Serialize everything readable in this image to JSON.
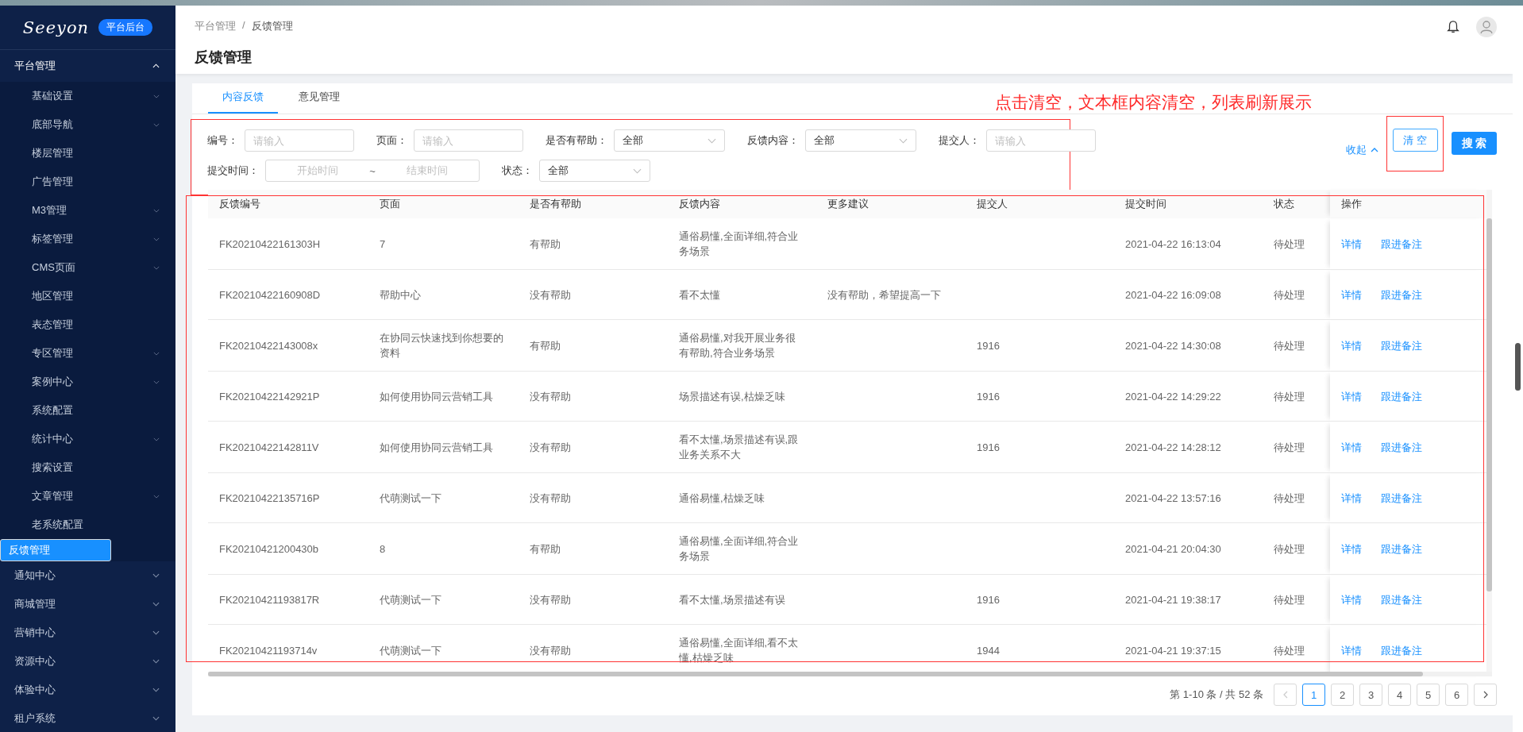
{
  "sidebar": {
    "logo": "Seeyon",
    "badge": "平台后台",
    "groups": [
      {
        "label": "平台管理",
        "expanded": true,
        "children": [
          {
            "label": "基础设置",
            "has_submenu": true,
            "selected": false
          },
          {
            "label": "底部导航",
            "has_submenu": true,
            "selected": false
          },
          {
            "label": "楼层管理",
            "has_submenu": false,
            "selected": false
          },
          {
            "label": "广告管理",
            "has_submenu": false,
            "selected": false
          },
          {
            "label": "M3管理",
            "has_submenu": true,
            "selected": false
          },
          {
            "label": "标签管理",
            "has_submenu": true,
            "selected": false
          },
          {
            "label": "CMS页面",
            "has_submenu": true,
            "selected": false
          },
          {
            "label": "地区管理",
            "has_submenu": false,
            "selected": false
          },
          {
            "label": "表态管理",
            "has_submenu": false,
            "selected": false
          },
          {
            "label": "专区管理",
            "has_submenu": true,
            "selected": false
          },
          {
            "label": "案例中心",
            "has_submenu": true,
            "selected": false
          },
          {
            "label": "系统配置",
            "has_submenu": false,
            "selected": false
          },
          {
            "label": "统计中心",
            "has_submenu": true,
            "selected": false
          },
          {
            "label": "搜索设置",
            "has_submenu": false,
            "selected": false
          },
          {
            "label": "文章管理",
            "has_submenu": true,
            "selected": false
          },
          {
            "label": "老系统配置",
            "has_submenu": false,
            "selected": false
          },
          {
            "label": "反馈管理",
            "has_submenu": false,
            "selected": true
          }
        ]
      },
      {
        "label": "通知中心",
        "expanded": false
      },
      {
        "label": "商城管理",
        "expanded": false
      },
      {
        "label": "营销中心",
        "expanded": false
      },
      {
        "label": "资源中心",
        "expanded": false
      },
      {
        "label": "体验中心",
        "expanded": false
      },
      {
        "label": "租户系统",
        "expanded": false
      }
    ]
  },
  "breadcrumb": [
    "平台管理",
    "反馈管理"
  ],
  "breadcrumb_separator": "/",
  "page_title": "反馈管理",
  "tabs": [
    {
      "label": "内容反馈",
      "selected": true
    },
    {
      "label": "意见管理",
      "selected": false
    }
  ],
  "annotation": "点击清空，文本框内容清空，列表刷新展示",
  "filters": [
    [
      {
        "kind": "input",
        "label": "编号：",
        "placeholder": "请输入"
      },
      {
        "kind": "input",
        "label": "页面：",
        "placeholder": "请输入"
      },
      {
        "kind": "select",
        "label": "是否有帮助：",
        "value": "全部"
      },
      {
        "kind": "select",
        "label": "反馈内容：",
        "value": "全部"
      },
      {
        "kind": "input",
        "label": "提交人：",
        "placeholder": "请输入"
      }
    ],
    [
      {
        "kind": "daterange",
        "label": "提交时间：",
        "start_placeholder": "开始时间",
        "separator": "~",
        "end_placeholder": "结束时间"
      },
      {
        "kind": "select",
        "label": "状态：",
        "value": "全部"
      }
    ]
  ],
  "collapse_link": "收起",
  "buttons": {
    "clear": "清 空",
    "search": "搜 索"
  },
  "table": {
    "columns": [
      "反馈编号",
      "页面",
      "是否有帮助",
      "反馈内容",
      "更多建议",
      "提交人",
      "提交时间",
      "状态",
      "操作"
    ],
    "rows": [
      {
        "id": "FK20210422161303H",
        "page": "7",
        "helpful": "有帮助",
        "content": "通俗易懂,全面详细,符合业务场景",
        "time": "2021-04-22 16:13:04",
        "status": "待处理",
        "actions": [
          "详情",
          "跟进备注"
        ]
      },
      {
        "id": "FK20210422160908D",
        "page": "帮助中心",
        "helpful": "没有帮助",
        "content": "看不太懂",
        "suggestion": "没有帮助，希望提高一下",
        "time": "2021-04-22 16:09:08",
        "status": "待处理",
        "actions": [
          "详情",
          "跟进备注"
        ]
      },
      {
        "id": "FK20210422143008x",
        "page": "在协同云快速找到你想要的资料",
        "helpful": "有帮助",
        "content": "通俗易懂,对我开展业务很有帮助,符合业务场景",
        "submitter": "1916",
        "time": "2021-04-22 14:30:08",
        "status": "待处理",
        "actions": [
          "详情",
          "跟进备注"
        ]
      },
      {
        "id": "FK20210422142921P",
        "page": "如何使用协同云营销工具",
        "helpful": "没有帮助",
        "content": "场景描述有误,枯燥乏味",
        "submitter": "1916",
        "time": "2021-04-22 14:29:22",
        "status": "待处理",
        "actions": [
          "详情",
          "跟进备注"
        ]
      },
      {
        "id": "FK20210422142811V",
        "page": "如何使用协同云营销工具",
        "helpful": "没有帮助",
        "content": "看不太懂,场景描述有误,跟业务关系不大",
        "submitter": "1916",
        "time": "2021-04-22 14:28:12",
        "status": "待处理",
        "actions": [
          "详情",
          "跟进备注"
        ]
      },
      {
        "id": "FK20210422135716P",
        "page": "代萌测试一下",
        "helpful": "没有帮助",
        "content": "通俗易懂,枯燥乏味",
        "time": "2021-04-22 13:57:16",
        "status": "待处理",
        "actions": [
          "详情",
          "跟进备注"
        ]
      },
      {
        "id": "FK20210421200430b",
        "page": "8",
        "helpful": "有帮助",
        "content": "通俗易懂,全面详细,符合业务场景",
        "time": "2021-04-21 20:04:30",
        "status": "待处理",
        "actions": [
          "详情",
          "跟进备注"
        ]
      },
      {
        "id": "FK20210421193817R",
        "page": "代萌测试一下",
        "helpful": "没有帮助",
        "content": "看不太懂,场景描述有误",
        "submitter": "1916",
        "time": "2021-04-21 19:38:17",
        "status": "待处理",
        "actions": [
          "详情",
          "跟进备注"
        ]
      },
      {
        "id": "FK20210421193714v",
        "page": "代萌测试一下",
        "helpful": "没有帮助",
        "content": "通俗易懂,全面详细,看不太懂,枯燥乏味",
        "submitter": "1944",
        "time": "2021-04-21 19:37:15",
        "status": "待处理",
        "actions": [
          "详情",
          "跟进备注"
        ]
      }
    ]
  },
  "pagination": {
    "summary": "第 1-10 条 / 共 52 条",
    "pages": [
      {
        "label": "1",
        "selected": true
      },
      {
        "label": "2",
        "selected": false
      },
      {
        "label": "3",
        "selected": false
      },
      {
        "label": "4",
        "selected": false
      },
      {
        "label": "5",
        "selected": false
      },
      {
        "label": "6",
        "selected": false
      }
    ]
  }
}
